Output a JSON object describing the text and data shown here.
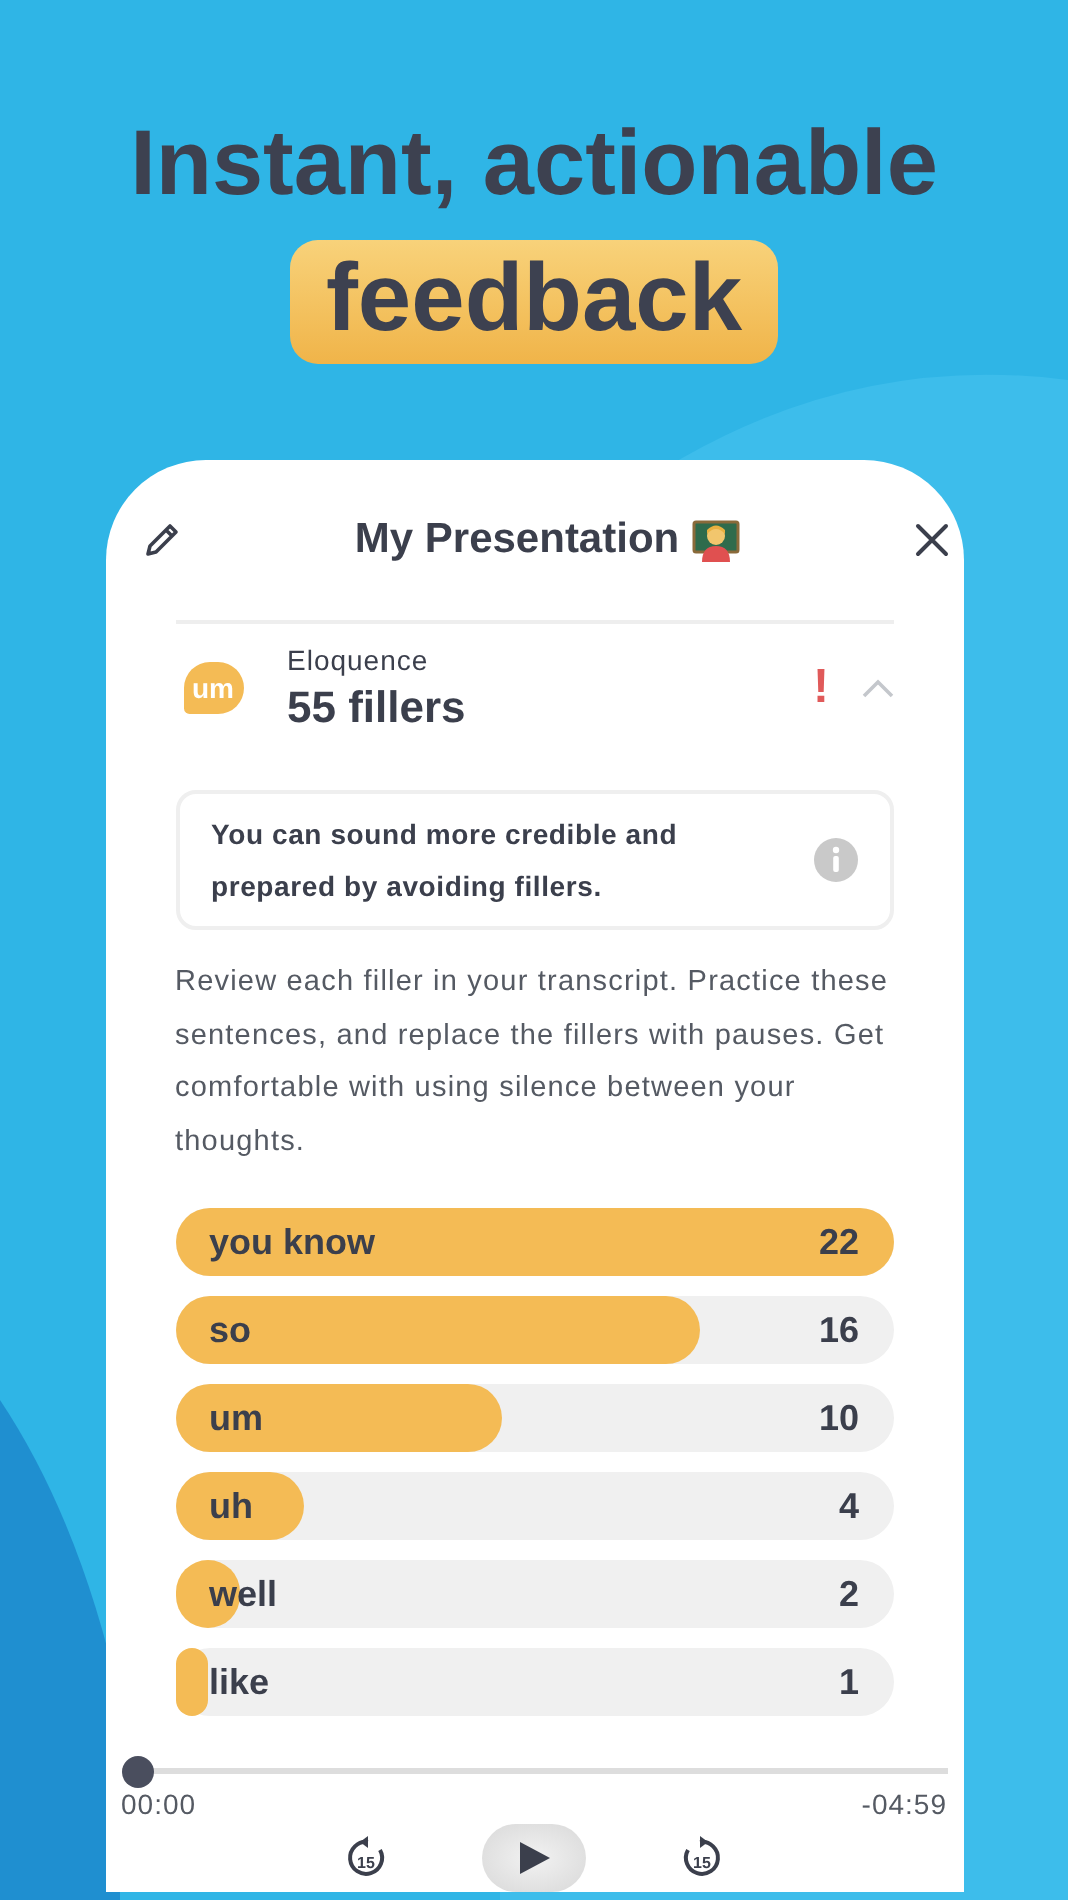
{
  "headline": {
    "line": "Instant, actionable",
    "highlight": "feedback"
  },
  "card": {
    "title": "My Presentation",
    "section": {
      "badge": "um",
      "label": "Eloquence",
      "value": "55 fillers",
      "alert": "!",
      "expanded": true
    },
    "tip": "You can sound more credible and prepared by avoiding fillers.",
    "description": "Review each filler in your transcript. Practice these sentences, and replace the fillers with pauses. Get comfortable with using silence between your thoughts.",
    "fillers": [
      {
        "label": "you know",
        "count": "22",
        "level": 1.0
      },
      {
        "label": "so",
        "count": "16",
        "level": 0.73
      },
      {
        "label": "um",
        "count": "10",
        "level": 0.455
      },
      {
        "label": "uh",
        "count": "4",
        "level": 0.18
      },
      {
        "label": "well",
        "count": "2",
        "level": 0.09
      },
      {
        "label": "like",
        "count": "1",
        "level": 0.045
      }
    ],
    "player": {
      "level": 0,
      "elapsed": "00:00",
      "remaining": "-04:59",
      "skip_back": "15",
      "skip_forward": "15"
    }
  }
}
